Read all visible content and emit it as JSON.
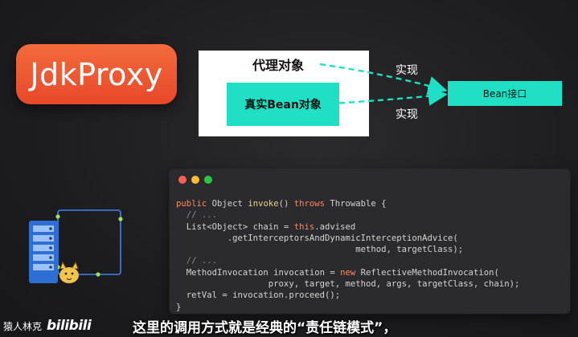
{
  "title_pill": {
    "text": "JdkProxy",
    "color": "#ea5530"
  },
  "diagram": {
    "proxy_object_label": "代理对象",
    "real_bean_label": "真实Bean对象",
    "bean_interface_label": "Bean接口",
    "implement_label_top": "实现",
    "implement_label_bottom": "实现",
    "accent_color": "#1fe0c4"
  },
  "code_window": {
    "window_buttons": [
      "close-icon",
      "minimize-icon",
      "zoom-icon"
    ],
    "lines": [
      [
        {
          "t": "public ",
          "c": "kw"
        },
        {
          "t": "Object ",
          "c": ""
        },
        {
          "t": "invoke",
          "c": "fn"
        },
        {
          "t": "() ",
          "c": ""
        },
        {
          "t": "throws ",
          "c": "kw"
        },
        {
          "t": "Throwable {",
          "c": ""
        }
      ],
      [
        {
          "t": "  // ...",
          "c": "cm"
        }
      ],
      [
        {
          "t": "  List<Object> chain = ",
          "c": ""
        },
        {
          "t": "this",
          "c": "kw"
        },
        {
          "t": ".advised",
          "c": ""
        }
      ],
      [
        {
          "t": "          .getInterceptorsAndDynamicInterceptionAdvice(",
          "c": ""
        }
      ],
      [
        {
          "t": "                                   method, targetClass);",
          "c": ""
        }
      ],
      [
        {
          "t": "  // ...",
          "c": "cm"
        }
      ],
      [
        {
          "t": "  MethodInvocation invocation = ",
          "c": ""
        },
        {
          "t": "new ",
          "c": "kw"
        },
        {
          "t": "ReflectiveMethodInvocation(",
          "c": ""
        }
      ],
      [
        {
          "t": "                  proxy, target, method, args, targetClass, chain);",
          "c": ""
        }
      ],
      [
        {
          "t": "  retVal = invocation.proceed();",
          "c": ""
        }
      ],
      [
        {
          "t": "}",
          "c": ""
        }
      ]
    ]
  },
  "watermark": {
    "author": "猿人林克",
    "brand": "bilibili"
  },
  "subtitle": "这里的调用方式就是经典的“责任链模式”，"
}
